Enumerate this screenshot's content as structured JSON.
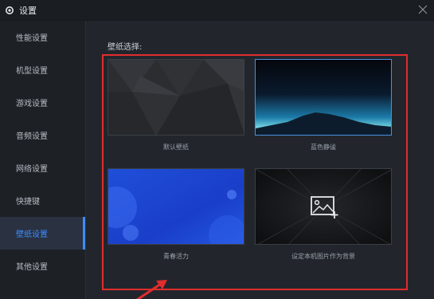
{
  "window": {
    "title": "设置",
    "close_icon": "close-icon",
    "settings_icon": "gear-icon"
  },
  "sidebar": {
    "items": [
      {
        "label": "性能设置"
      },
      {
        "label": "机型设置"
      },
      {
        "label": "游戏设置"
      },
      {
        "label": "音频设置"
      },
      {
        "label": "网络设置"
      },
      {
        "label": "快捷键"
      },
      {
        "label": "壁纸设置"
      },
      {
        "label": "其他设置"
      }
    ],
    "active_index": 6
  },
  "main": {
    "section_title": "壁纸选择:",
    "wallpapers": [
      {
        "label": "默认壁纸",
        "selected": false
      },
      {
        "label": "蓝色静谧",
        "selected": true
      },
      {
        "label": "青春活力",
        "selected": false
      },
      {
        "label": "设定本机图片作为背景",
        "selected": false,
        "icon": "add-image-icon"
      }
    ]
  },
  "colors": {
    "accent": "#3d8cff",
    "highlight_box": "#e02d2d",
    "background": "#22262c"
  }
}
